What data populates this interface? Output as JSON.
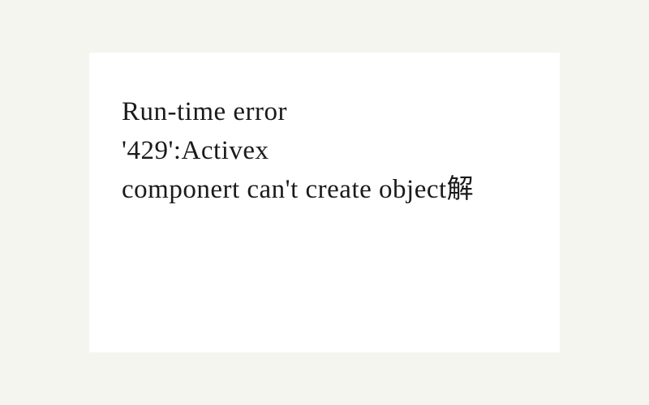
{
  "error": {
    "line1": "Run-time error",
    "line2": "'429':Activex",
    "line3": "componert can't create object解"
  }
}
